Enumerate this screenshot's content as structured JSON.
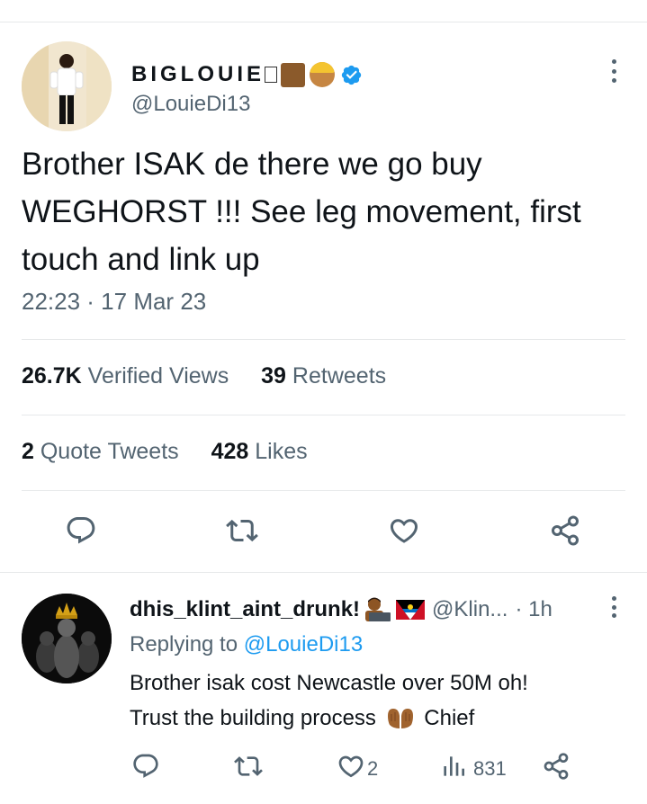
{
  "main_tweet": {
    "display_name": "BIGLOUIE",
    "handle": "@LouieDi13",
    "text": "Brother ISAK de there we go buy WEGHORST !!! See leg movement, first touch and link up",
    "timestamp": "22:23 · 17 Mar 23",
    "stats": {
      "views_count": "26.7K",
      "views_label": "Verified Views",
      "retweets_count": "39",
      "retweets_label": "Retweets",
      "quotes_count": "2",
      "quotes_label": "Quote Tweets",
      "likes_count": "428",
      "likes_label": "Likes"
    },
    "actions": [
      "reply-icon",
      "retweet-icon",
      "like-icon",
      "share-icon"
    ]
  },
  "reply_tweet": {
    "display_name": "dhis_klint_aint_drunk!",
    "handle": "@Klin...",
    "time": "· 1h",
    "replying_prefix": "Replying to",
    "replying_to": "@LouieDi13",
    "text_line1": "Brother isak cost Newcastle over 50M oh!",
    "text_line2_a": "Trust the building process",
    "text_line2_b": "Chief",
    "likes": "2",
    "views": "831",
    "actions": [
      "reply-icon",
      "retweet-icon",
      "like-icon",
      "views-icon",
      "share-icon"
    ]
  },
  "colors": {
    "text_primary": "#0f1419",
    "text_secondary": "#536471",
    "accent": "#1d9bf0",
    "divider": "#e7e9ea"
  }
}
